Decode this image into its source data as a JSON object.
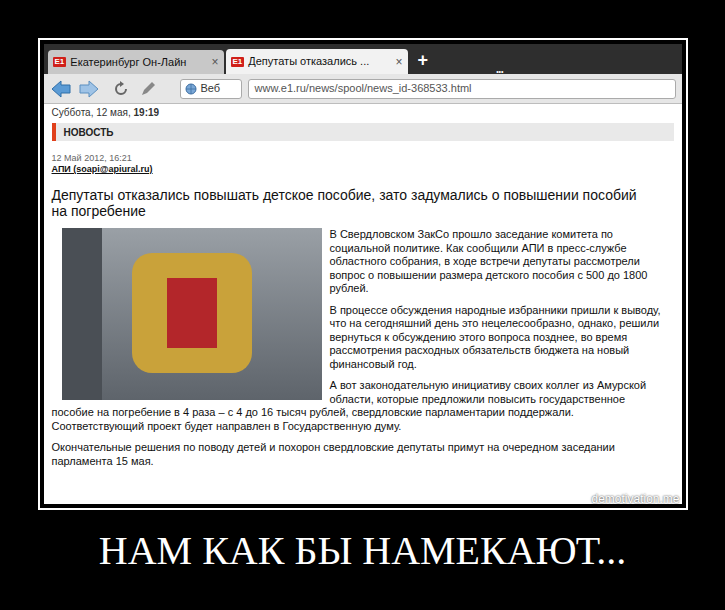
{
  "tabs": [
    {
      "icon": "E1",
      "label": "Екатеринбург Он-Лайн",
      "close": "×",
      "selected": false
    },
    {
      "icon": "E1",
      "label": "Депутаты отказались ...",
      "close": "×",
      "selected": true
    }
  ],
  "new_tab": "+",
  "tab_overflow": "•••",
  "toolbar": {
    "search_label": "Веб",
    "url": "www.e1.ru/news/spool/news_id-368533.html"
  },
  "page": {
    "date": "Суббота, 12 мая,",
    "time": "19:19",
    "section": "НОВОСТЬ",
    "article": {
      "date": "12 Май 2012, 16:21",
      "source": "АПИ (soapi@apiural.ru)",
      "headline": "Депутаты отказались повышать детское пособие, зато задумались о повышении пособий на погребение",
      "paragraphs": [
        "В Свердловском ЗакСо прошло заседание комитета по социальной политике. Как сообщили АПИ в пресс-службе областного собрания, в ходе встречи депутаты рассмотрели вопрос о повышении размера детского пособия с 500 до 1800 рублей.",
        "В процессе обсуждения народные избранники пришли к выводу, что на сегодняшний день это нецелесообразно, однако, решили вернуться к обсуждению этого вопроса позднее, во время рассмотрения расходных обязательств бюджета на новый финансовый год.",
        "А вот законодательную инициативу своих коллег из Амурской области, которые предложили повысить государственное пособие на погребение в 4 раза – с 4 до 16 тысяч рублей, свердловские парламентарии поддержали. Соответствующий проект будет направлен в Государственную думу.",
        "Окончательные решения по поводу детей и похорон свердловские депутаты примут на очередном заседании парламента 15 мая."
      ]
    }
  },
  "watermark": "demotivation.me",
  "caption": "НАМ КАК БЫ НАМЕКАЮТ..."
}
